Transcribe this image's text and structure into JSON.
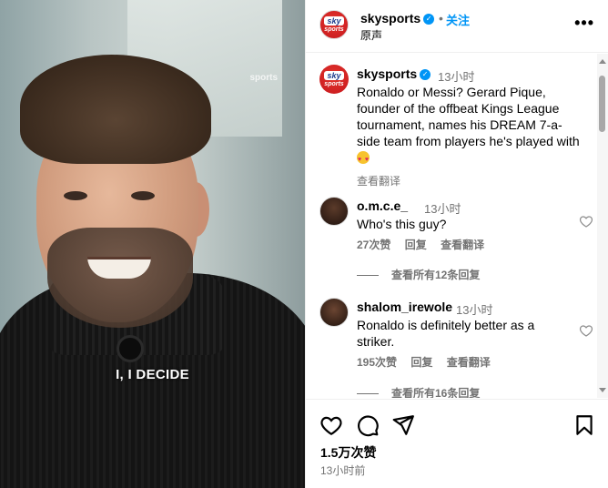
{
  "video": {
    "caption_text": "I, I DECIDE",
    "watermark": "sports"
  },
  "header": {
    "username": "skysports",
    "dot": "•",
    "follow_label": "关注",
    "audio_label": "原声",
    "more_label": "•••"
  },
  "avatar": {
    "line1": "sky",
    "line2": "sports"
  },
  "post": {
    "username": "skysports",
    "time": "13小时",
    "text": "Ronaldo or Messi? Gerard Pique, founder of the offbeat Kings League tournament, names his DREAM 7-a-side team from players he's played with",
    "translate_label": "查看翻译"
  },
  "comments": [
    {
      "username": "o.m.c.e_",
      "time": "13小时",
      "text": "Who's this guy?",
      "likes": "27次赞",
      "reply_label": "回复",
      "translate_label": "查看翻译",
      "view_replies": "查看所有12条回复"
    },
    {
      "username": "shalom_irewole",
      "time": "13小时",
      "text": "Ronaldo is definitely better as a striker.",
      "likes": "195次赞",
      "reply_label": "回复",
      "translate_label": "查看翻译",
      "view_replies": "查看所有16条回复"
    }
  ],
  "footer": {
    "likes": "1.5万次赞",
    "time": "13小时前"
  },
  "icons": [
    "heart-icon",
    "comment-icon",
    "share-icon",
    "bookmark-icon",
    "more-icon",
    "verified-icon"
  ],
  "colors": {
    "accent": "#0095f6",
    "muted": "#737373",
    "brand_red": "#d31a20"
  }
}
